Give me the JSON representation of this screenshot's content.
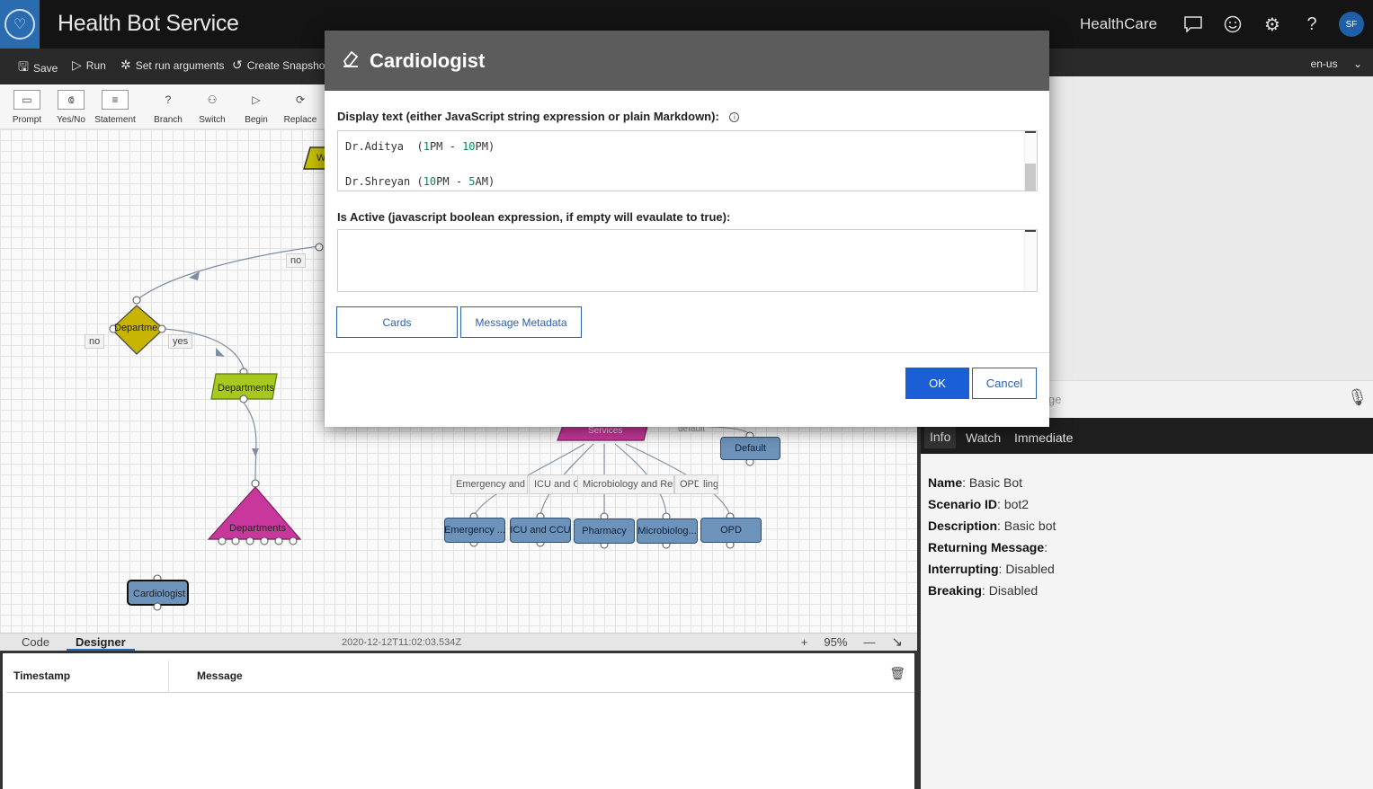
{
  "header": {
    "app_title": "Health Bot Service",
    "tenant": "HealthCare",
    "avatar_initials": "SF"
  },
  "toolbar": {
    "save": "Save",
    "run": "Run",
    "set_run_arguments": "Set run arguments",
    "create_snapshot": "Create Snapshot",
    "locale": "en-us"
  },
  "palette": [
    {
      "label": "Prompt",
      "icon": "prompt-icon"
    },
    {
      "label": "Yes/No",
      "icon": "yesno-icon"
    },
    {
      "label": "Statement",
      "icon": "statement-icon"
    },
    {
      "label": "Branch",
      "icon": "branch-icon"
    },
    {
      "label": "Switch",
      "icon": "switch-icon"
    },
    {
      "label": "Begin",
      "icon": "begin-icon"
    },
    {
      "label": "Replace",
      "icon": "replace-icon"
    }
  ],
  "canvas": {
    "node_welcome_partial": "W",
    "edge_no_top": "no",
    "diamond_label": "Departme",
    "edge_no_left": "no",
    "edge_yes": "yes",
    "departments_prompt": "Departments",
    "departments_switch": "Departments",
    "cardiologist_node": "Cardiologist",
    "services_node": "Services",
    "edge_default": "default",
    "default_node": "Default",
    "service_labels": [
      "Emergency and Ti",
      "ICU and C(",
      "Microbiology and Rese",
      "OPD",
      "ling"
    ],
    "service_nodes": [
      "Emergency ...",
      "ICU and CCU",
      "Pharmacy",
      "Microbiolog...",
      "OPD"
    ]
  },
  "bottom": {
    "tab_code": "Code",
    "tab_designer": "Designer",
    "timestamp": "2020-12-12T11:02:03.534Z",
    "zoom": "95%"
  },
  "log": {
    "col_timestamp": "Timestamp",
    "col_message": "Message"
  },
  "chat": {
    "input_placeholder_partial": "ge"
  },
  "info_tabs": [
    "Info",
    "Watch",
    "Immediate"
  ],
  "info": {
    "name_label": "Name",
    "name_value": "Basic Bot",
    "scenario_label": "Scenario ID",
    "scenario_value": "bot2",
    "description_label": "Description",
    "description_value": "Basic bot",
    "returning_label": "Returning Message",
    "returning_value": "",
    "interrupting_label": "Interrupting",
    "interrupting_value": "Disabled",
    "breaking_label": "Breaking",
    "breaking_value": "Disabled"
  },
  "modal": {
    "title": "Cardiologist",
    "display_text_label": "Display text (either JavaScript string expression or plain Markdown):",
    "line1_name": "Dr.Aditya  (",
    "line1_n1": "1",
    "line1_mid": "PM - ",
    "line1_n2": "10",
    "line1_end": "PM)",
    "line2_name": "Dr.Shreyan (",
    "line2_n1": "10",
    "line2_mid": "PM - ",
    "line2_n2": "5",
    "line2_end": "AM)",
    "is_active_label": "Is Active (javascript boolean expression, if empty will evaulate to true):",
    "is_active_value": "",
    "cards_button": "Cards",
    "metadata_button": "Message Metadata",
    "ok_button": "OK",
    "cancel_button": "Cancel"
  }
}
